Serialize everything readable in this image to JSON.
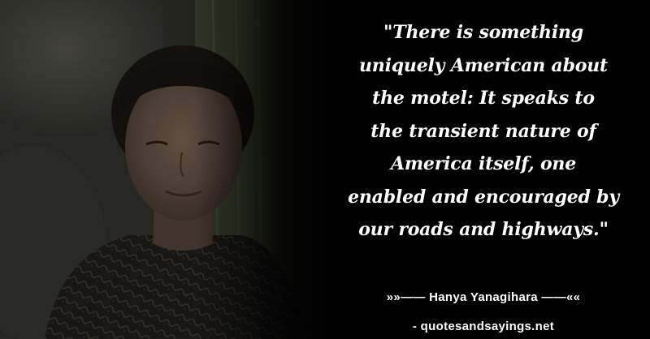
{
  "quote": {
    "lines": [
      "\"There is something",
      "uniquely American about",
      "the motel: It speaks to",
      "the transient nature of",
      "America itself, one",
      "enabled and encouraged by",
      "our roads and highways.\""
    ]
  },
  "author_line": "»»—— Hanya Yanagihara ——««",
  "source_line": "- quotesandsayings.net",
  "colors": {
    "background": "#000000",
    "text": "#ffffff"
  }
}
